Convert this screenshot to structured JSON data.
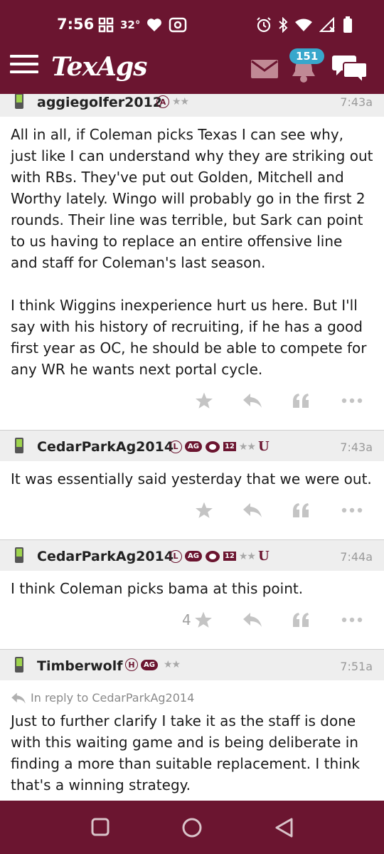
{
  "status_bar": {
    "time": "7:56",
    "temperature": "32°"
  },
  "app_bar": {
    "logo": "TexAgs",
    "notification_count": "151"
  },
  "posts": [
    {
      "username": "aggiegolfer2012",
      "time": "7:43a",
      "paragraphs": [
        "All in all, if Coleman picks Texas I can see why, just like I can understand why they are striking out with RBs. They've put out Golden, Mitchell and Worthy lately. Wingo will probably go in the first 2 rounds. Their line was terrible, but Sark can point to us having to replace an entire offensive line and staff for Coleman's last season.",
        "I think Wiggins inexperience hurt us here. But I'll say with his history of recruiting, if he has a good first year as OC, he should be able to compete for any WR he wants next portal cycle."
      ],
      "badges": {
        "letter": "A",
        "stars": "★★"
      }
    },
    {
      "username": "CedarParkAg2014",
      "time": "7:43a",
      "paragraphs": [
        "It was essentially said yesterday that we were out."
      ],
      "badges": {
        "letter": "L",
        "ag": "AG",
        "twelve": "12",
        "stars": "★★",
        "u": "U"
      }
    },
    {
      "username": "CedarParkAg2014",
      "time": "7:44a",
      "paragraphs": [
        "I think Coleman picks bama at this point."
      ],
      "star_count": "4",
      "badges": {
        "letter": "L",
        "ag": "AG",
        "twelve": "12",
        "stars": "★★",
        "u": "U"
      }
    },
    {
      "username": "Timberwolf",
      "time": "7:51a",
      "reply_to": "In reply to CedarParkAg2014",
      "paragraphs": [
        "Just to further clarify I take it as the staff is done with this waiting game and is being deliberate in finding a more than suitable replacement. I think that's a winning strategy."
      ],
      "badges": {
        "letter": "H",
        "ag": "AG",
        "stars": "★★"
      }
    }
  ],
  "colors": {
    "maroon": "#6b1530",
    "badge_blue": "#38a7cc",
    "icon_grey": "#c4c4c4",
    "header_grey": "#eeeeee"
  },
  "icons": [
    "menu-icon",
    "mail-icon",
    "bell-icon",
    "chat-icon",
    "phone-icon",
    "star-icon",
    "reply-icon",
    "quote-icon",
    "more-icon",
    "nav-recents-icon",
    "nav-home-icon",
    "nav-back-icon"
  ]
}
